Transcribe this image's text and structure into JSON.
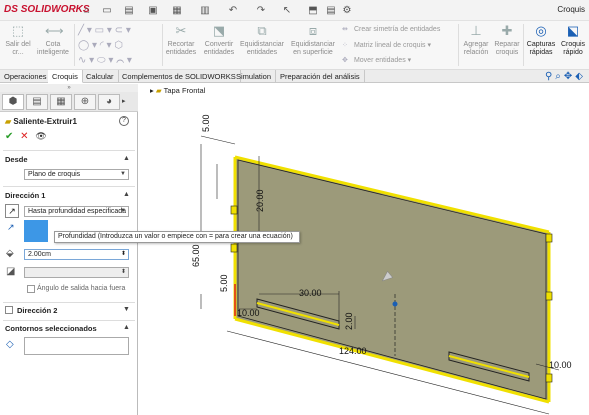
{
  "app": {
    "logo": "SOLIDWORKS",
    "logo_mark": "DS",
    "window_title": "Croquis"
  },
  "ribbon": {
    "exit_sketch": "Salir del cr...",
    "smart_dimension": "Cota inteligente",
    "trim": "Recortar entidades",
    "convert": "Convertir entidades",
    "offset": "Equidistanciar entidades",
    "offset_surface": "Equidistanciar en superficie",
    "mirror": "Crear simetría de entidades",
    "linear_pattern": "Matriz lineal de croquis",
    "move": "Mover entidades",
    "add_relation": "Agregar relación",
    "repair": "Reparar croquis",
    "quick_snaps": "Capturas rápidas",
    "rapid_sketch": "Croquis rápido"
  },
  "tabs": [
    "Operaciones",
    "Croquis",
    "Calcular",
    "Complementos de SOLIDWORKS",
    "Simulation",
    "Preparación del análisis"
  ],
  "active_tab": 1,
  "tree": {
    "item": "Tapa Frontal"
  },
  "pm": {
    "handle": "»",
    "title": "Saliente-Extruir1",
    "help": "?",
    "ok": "✔",
    "cancel": "✕",
    "preview": "👁",
    "from_header": "Desde",
    "from_value": "Plano de croquis",
    "dir1_header": "Dirección 1",
    "dir1_type": "Hasta profundidad especificada",
    "depth_value": "2.00cm",
    "draft_label": "Ángulo de salida hacia fuera",
    "dir2_header": "Dirección 2",
    "contours_header": "Contornos seleccionados",
    "tooltip": "Profundidad (Introduzca un valor o empiece con = para crear una ecuación)"
  },
  "dims": {
    "d_top": "5.00",
    "d_20": "20.00",
    "d_65": "65.00",
    "d_5b": "5.00",
    "d_30": "30.00",
    "d_10a": "10.00",
    "d_2": "2.00",
    "d_124": "124.00",
    "d_10b": "10.00"
  },
  "colors": {
    "accent": "#1a5fb4",
    "face": "#9c9a7a",
    "edge": "#f0e000",
    "tooltip_bar": "#3d97e6"
  }
}
